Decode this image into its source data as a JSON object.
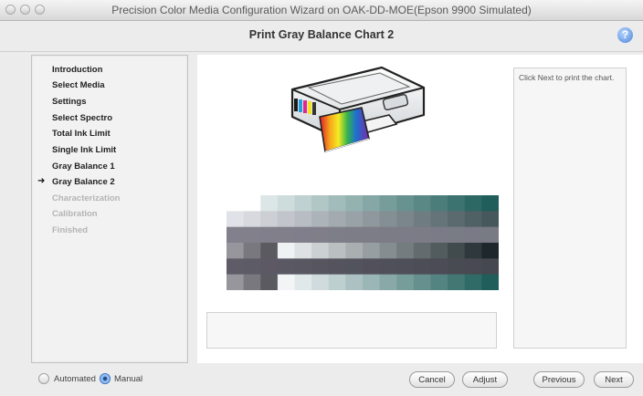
{
  "window": {
    "title": "Precision Color Media Configuration Wizard on OAK-DD-MOE(Epson 9900 Simulated)"
  },
  "header": {
    "page_title": "Print Gray Balance Chart 2",
    "help_label": "?"
  },
  "sidebar": {
    "current_marker": "➜",
    "steps": [
      {
        "label": "Introduction",
        "state": "done"
      },
      {
        "label": "Select Media",
        "state": "done"
      },
      {
        "label": "Settings",
        "state": "done"
      },
      {
        "label": "Select Spectro",
        "state": "done"
      },
      {
        "label": "Total Ink Limit",
        "state": "done"
      },
      {
        "label": "Single Ink Limit",
        "state": "done"
      },
      {
        "label": "Gray Balance 1",
        "state": "done"
      },
      {
        "label": "Gray Balance 2",
        "state": "current"
      },
      {
        "label": "Characterization",
        "state": "disabled"
      },
      {
        "label": "Calibration",
        "state": "disabled"
      },
      {
        "label": "Finished",
        "state": "disabled"
      }
    ]
  },
  "info": {
    "text": "Click Next to print the chart."
  },
  "mode": {
    "automated_label": "Automated",
    "manual_label": "Manual",
    "selected": "Manual"
  },
  "buttons": {
    "cancel": "Cancel",
    "adjust": "Adjust",
    "previous": "Previous",
    "next": "Next"
  },
  "colors": {
    "accent": "#4b84d8",
    "chart_teal": "#1f5e5a",
    "chart_dark": "#252a2e"
  }
}
